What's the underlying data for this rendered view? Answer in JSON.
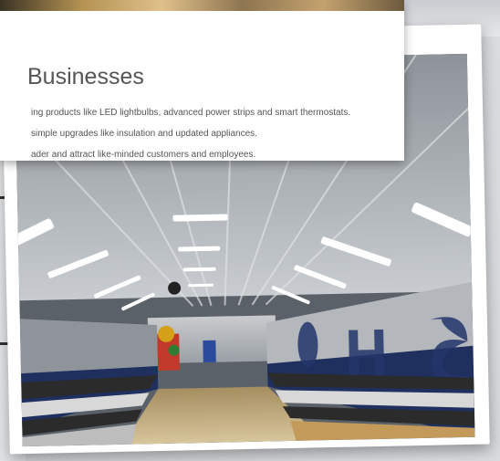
{
  "section": {
    "title": "Businesses",
    "bullets": [
      "ing products like LED lightbulbs, advanced power strips and smart thermostats.",
      " simple upgrades like insulation and updated appliances.",
      "ader and attract like-minded customers and employees."
    ]
  },
  "photo": {
    "subject": "gymnasium with LED ceiling lights",
    "wall_letters": "O H S"
  },
  "colors": {
    "photo_frame": "#ffffff",
    "background": "#d9dcdf",
    "text": "#555555"
  }
}
